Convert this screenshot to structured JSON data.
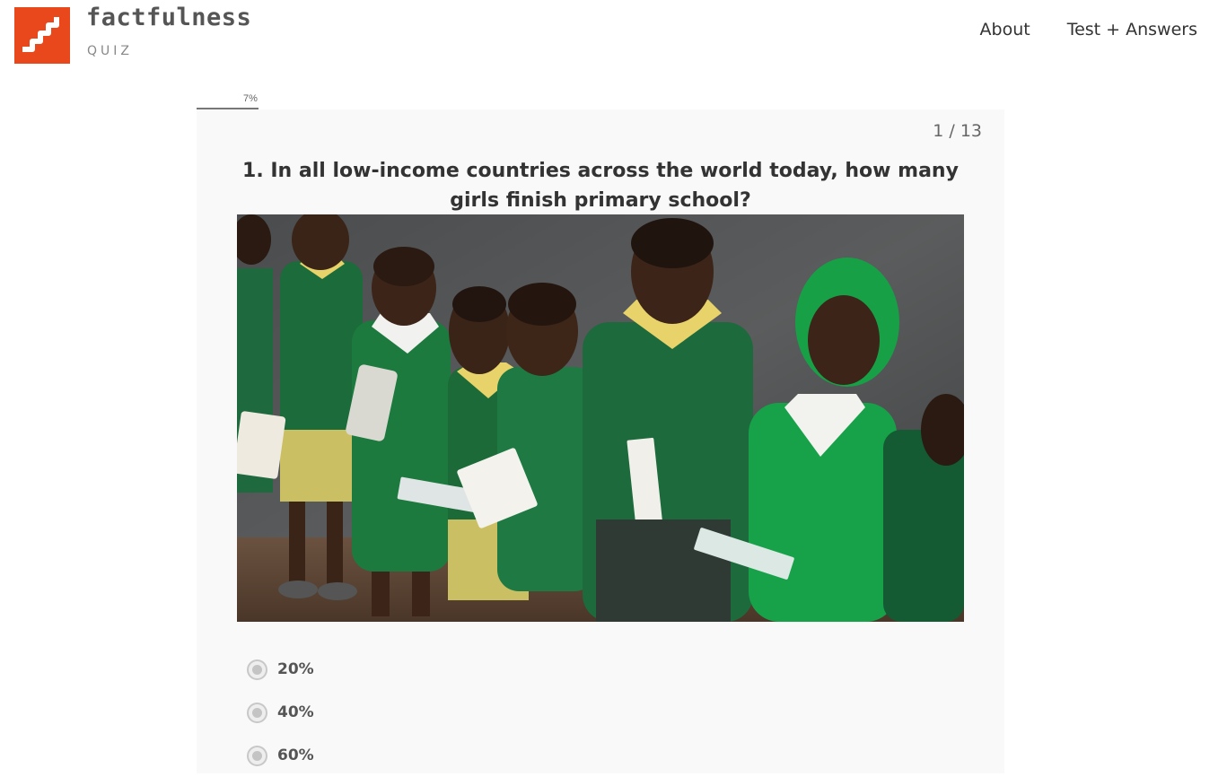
{
  "header": {
    "logo_word": "factfulness",
    "logo_sub": "QUIZ",
    "nav": [
      {
        "label": "About"
      },
      {
        "label": "Test + Answers"
      }
    ]
  },
  "progress": {
    "label": "7%",
    "fraction": 0.077
  },
  "quiz": {
    "counter": "1 / 13",
    "question": "1. In all low-income countries across the world today, how many girls finish primary school?",
    "options": [
      {
        "label": "20%"
      },
      {
        "label": "40%"
      },
      {
        "label": "60%"
      }
    ]
  },
  "colors": {
    "brand": "#e8481c",
    "uniform_green": "#1f6b3c",
    "background": "#f9f9f9"
  }
}
